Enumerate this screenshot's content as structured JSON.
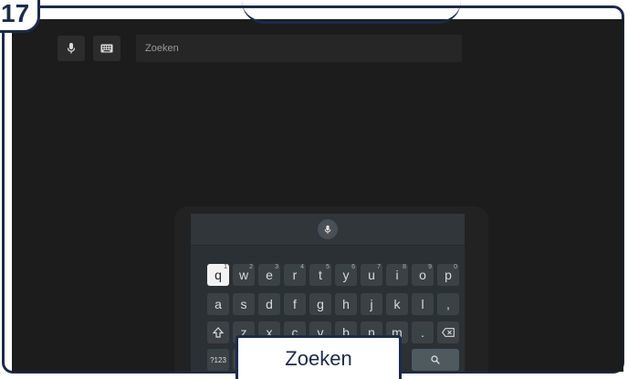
{
  "step_number": "17",
  "search": {
    "placeholder": "Zoeken"
  },
  "icons": {
    "mic": "microphone-icon",
    "keyboard": "keyboard-icon",
    "backspace": "backspace-icon",
    "shift": "shift-icon",
    "search": "search-icon"
  },
  "keyboard": {
    "row1": [
      {
        "label": "q",
        "sup": "1"
      },
      {
        "label": "w",
        "sup": "2"
      },
      {
        "label": "e",
        "sup": "3"
      },
      {
        "label": "r",
        "sup": "4"
      },
      {
        "label": "t",
        "sup": "5"
      },
      {
        "label": "y",
        "sup": "6"
      },
      {
        "label": "u",
        "sup": "7"
      },
      {
        "label": "i",
        "sup": "8"
      },
      {
        "label": "o",
        "sup": "9"
      },
      {
        "label": "p",
        "sup": "0"
      }
    ],
    "row2": [
      "a",
      "s",
      "d",
      "f",
      "g",
      "h",
      "j",
      "k",
      "l",
      ","
    ],
    "row3": [
      "z",
      "x",
      "c",
      "v",
      "b",
      "n",
      "m",
      "."
    ],
    "symbols_label": "?123"
  },
  "caption": "Zoeken",
  "colors": {
    "frame_border": "#1c2b4a",
    "screen_bg": "#1c1c1c",
    "key_bg": "#3b4246",
    "selected_key_bg": "#f2f2f2"
  }
}
